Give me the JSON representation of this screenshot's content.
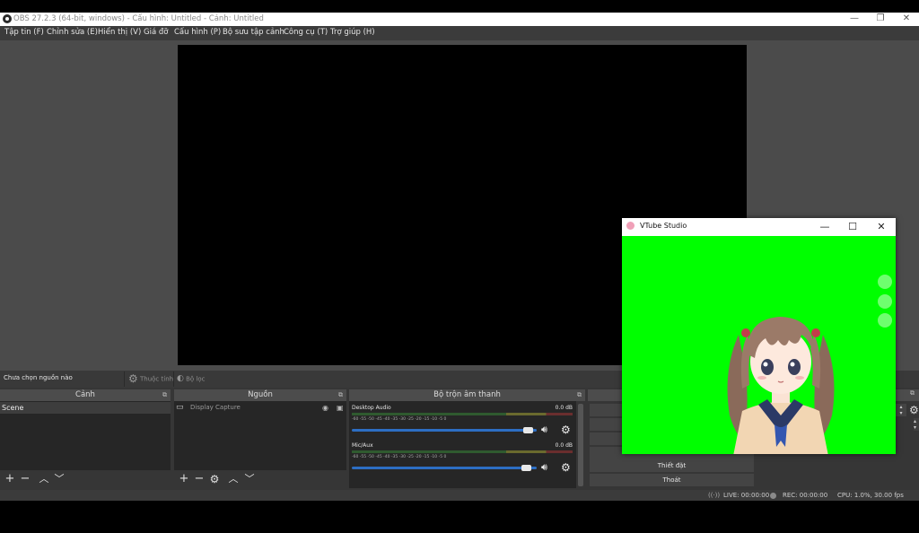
{
  "window": {
    "title": "OBS 27.2.3 (64-bit, windows) - Cấu hình: Untitled - Cảnh: Untitled",
    "controls": [
      "—",
      "❐",
      "✕"
    ]
  },
  "menu": [
    "Tập tin (F)",
    "Chỉnh sửa (E)",
    "Hiển thị (V)",
    "Giá đỡ",
    "Cấu hình (P)",
    "Bộ sưu tập cảnh",
    "Công cụ (T)",
    "Trợ giúp (H)"
  ],
  "source_toolbar": {
    "status": "Chưa chọn nguồn nào",
    "properties_label": "Thuộc tính",
    "filters_label": "Bộ lọc"
  },
  "scenes": {
    "header": "Cảnh",
    "items": [
      "Scene"
    ]
  },
  "sources": {
    "header": "Nguồn",
    "items": [
      "Display Capture"
    ]
  },
  "mixer": {
    "header": "Bộ trộn âm thanh",
    "ticks": "-60 -55 -50 -45 -40 -35 -30 -25 -20 -15 -10 -5 0",
    "channels": [
      {
        "name": "Desktop Audio",
        "db": "0.0 dB",
        "volume": 0.98
      },
      {
        "name": "Mic/Aux",
        "db": "0.0 dB",
        "volume": 0.97
      }
    ]
  },
  "controls": {
    "settings_label": "Thiết đặt",
    "exit_label": "Thoát"
  },
  "status": {
    "live": "LIVE: 00:00:00",
    "rec": "REC: 00:00:00",
    "cpu": "CPU: 1.0%, 30.00 fps"
  },
  "vtube": {
    "title": "VTube Studio",
    "background_color": "#00ff00"
  },
  "colors": {
    "accent": "#2d6ec3",
    "panel": "#4b4b4b",
    "dock": "#363636"
  }
}
